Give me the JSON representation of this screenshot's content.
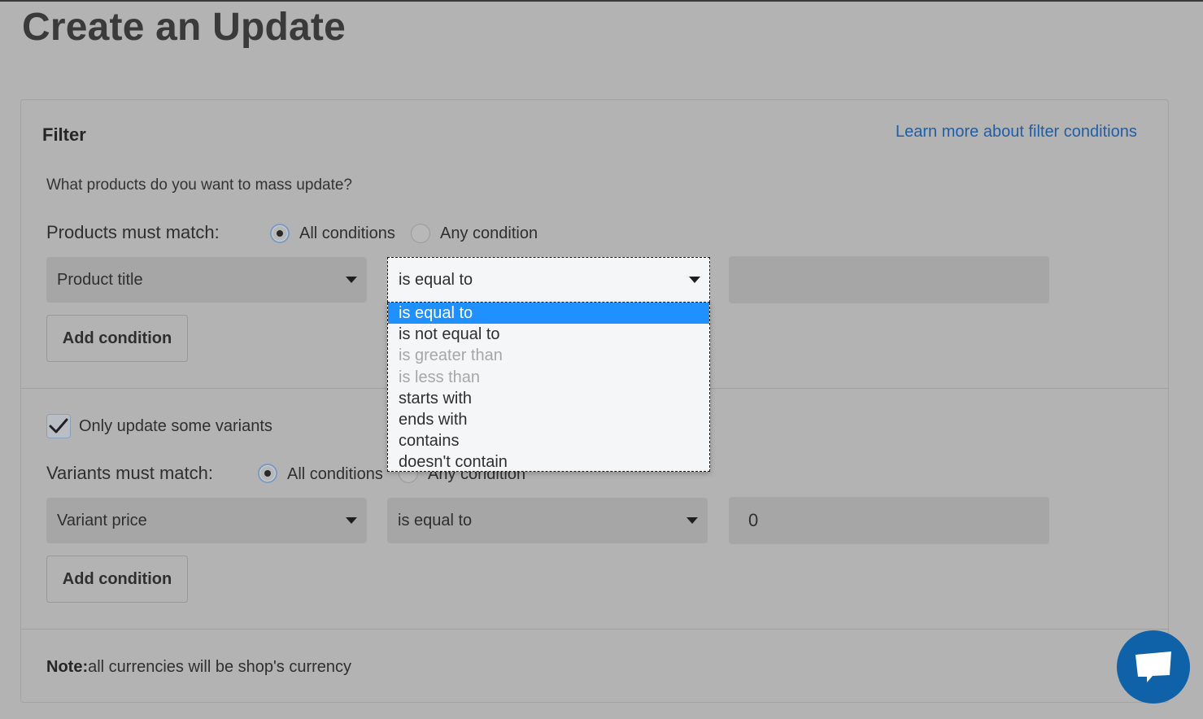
{
  "page": {
    "title": "Create an Update"
  },
  "filter": {
    "title": "Filter",
    "learn_more_link": "Learn more about filter conditions",
    "question": "What products do you want to mass update?",
    "products": {
      "match_label": "Products must match:",
      "option_all": "All conditions",
      "option_any": "Any condition",
      "selected": "All conditions",
      "field_select": "Product title",
      "operator_select": "is equal to",
      "value": "",
      "add_condition": "Add condition"
    },
    "variants": {
      "checkbox_label": "Only update some variants",
      "checked": true,
      "match_label": "Variants must match:",
      "option_all": "All conditions",
      "option_any": "Any condition",
      "selected": "All conditions",
      "field_select": "Variant price",
      "operator_select": "is equal to",
      "value": "0",
      "add_condition": "Add condition"
    },
    "note": {
      "label": "Note:",
      "text": "all currencies will be shop's currency"
    }
  },
  "dropdown": {
    "current": "is equal to",
    "options": [
      {
        "label": "is equal to",
        "state": "selected"
      },
      {
        "label": "is not equal to",
        "state": "normal"
      },
      {
        "label": "is greater than",
        "state": "disabled"
      },
      {
        "label": "is less than",
        "state": "disabled"
      },
      {
        "label": "starts with",
        "state": "normal"
      },
      {
        "label": "ends with",
        "state": "normal"
      },
      {
        "label": "contains",
        "state": "normal"
      },
      {
        "label": "doesn't contain",
        "state": "normal"
      }
    ]
  },
  "icons": {
    "chat": "chat-bubble-icon",
    "caret": "caret-down-icon",
    "check": "checkmark-icon"
  },
  "colors": {
    "accent": "#1e90ff",
    "link": "#1f5fa8",
    "chat_button": "#0f62a8"
  }
}
